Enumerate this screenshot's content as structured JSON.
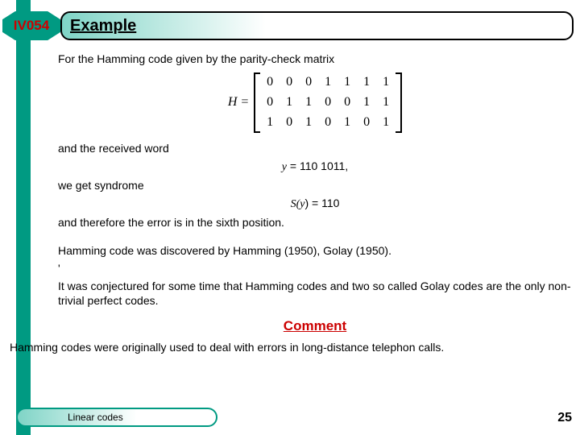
{
  "badge": "IV054",
  "title": "Example",
  "body": {
    "p1": "For the Hamming code given by the parity-check matrix",
    "matrix_label": "H = ",
    "p2": "and the received word",
    "y_line": "y = 110 1011,",
    "p3": "we get syndrome",
    "s_line_a": "S(",
    "s_line_b": "y",
    "s_line_c": ") = 110",
    "p4": "and therefore the error is in the sixth position.",
    "p5": "Hamming code was discovered by Hamming (1950), Golay (1950).",
    "p6a": "'",
    "p6": "It was conjectured for some time that Hamming codes and two so called Golay codes are the only non-trivial perfect codes.",
    "comment": "Comment",
    "p7": "Hamming codes were originally used to deal with errors in long-distance telephon calls."
  },
  "footer": "Linear codes",
  "page_number": "25",
  "chart_data": {
    "type": "table",
    "rows": [
      [
        "0",
        "0",
        "0",
        "1",
        "1",
        "1",
        "1"
      ],
      [
        "0",
        "1",
        "1",
        "0",
        "0",
        "1",
        "1"
      ],
      [
        "1",
        "0",
        "1",
        "0",
        "1",
        "0",
        "1"
      ]
    ]
  }
}
